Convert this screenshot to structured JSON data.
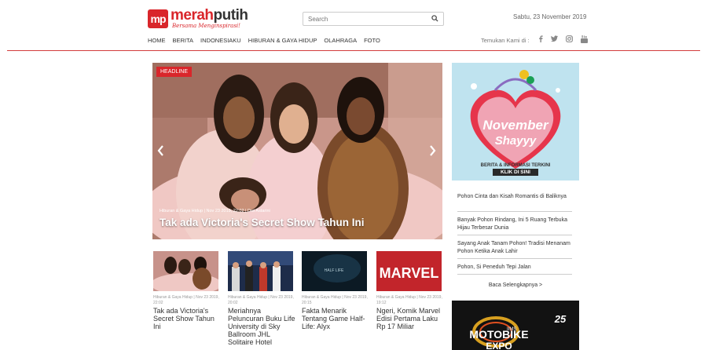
{
  "header": {
    "logo_mark": "mp",
    "logo_part1": "merah",
    "logo_part2": "putih",
    "tagline": "Bersama Menginspirasi!",
    "search_placeholder": "Search",
    "date": "Sabtu, 23 November 2019",
    "follow_label": "Temukan Kami di :",
    "social_icons": [
      "facebook-icon",
      "twitter-icon",
      "instagram-icon",
      "youtube-icon"
    ]
  },
  "nav": {
    "items": [
      "HOME",
      "BERITA",
      "INDONESIAKU",
      "HIBURAN & GAYA HIDUP",
      "OLAHRAGA",
      "FOTO"
    ]
  },
  "hero": {
    "badge": "HEADLINE",
    "meta": "Hiburan & Gaya Hidup | Nov 23 2019, 22:02 | Dwi Astarini",
    "title": "Tak ada Victoria's Secret Show Tahun Ini"
  },
  "thumbs": [
    {
      "meta": "Hiburan & Gaya Hidup | Nov 23 2019, 22:02",
      "title": "Tak ada Victoria's Secret Show Tahun Ini"
    },
    {
      "meta": "Hiburan & Gaya Hidup | Nov 23 2019, 20:02",
      "title": "Meriahnya Peluncuran Buku Life University di Sky Ballroom JHL Solitaire Hotel"
    },
    {
      "meta": "Hiburan & Gaya Hidup | Nov 23 2019, 20:15",
      "title": "Fakta Menarik Tentang Game Half-Life: Alyx"
    },
    {
      "meta": "Hiburan & Gaya Hidup | Nov 23 2019, 19:12",
      "title": "Ngeri, Komik Marvel Edisi Pertama Laku Rp 17 Miliar"
    }
  ],
  "ad": {
    "line1": "November",
    "line2": "Shayyy",
    "cta1": "BERITA & INFORMASI TERKINI",
    "cta2": "KLIK DI SINI"
  },
  "sidebar": {
    "items": [
      "Pohon Cinta dan Kisah Romantis di Baliknya",
      "Banyak Pohon Rindang, Ini 5 Ruang Terbuka Hijau Terbesar Dunia",
      "Sayang Anak Tanam Pohon! Tradisi Menanam Pohon Ketika Anak Lahir",
      "Pohon, Si Peneduh Tepi Jalan"
    ],
    "readmore": "Baca Selengkapnya >"
  },
  "ad2": {
    "text1": "MOTOBIKE",
    "text2": "IIMS",
    "text3": "EXPO",
    "badge": "25"
  },
  "thumb3_text": "HALF LIFE",
  "thumb4_text": "MARVEL"
}
